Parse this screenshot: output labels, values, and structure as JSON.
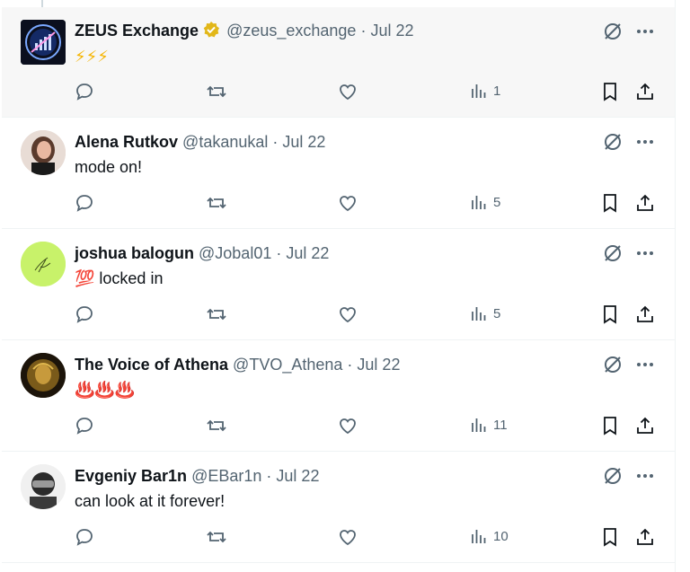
{
  "posts": [
    {
      "name": "ZEUS Exchange",
      "verified": true,
      "handle": "@zeus_exchange",
      "sep": "·",
      "date": "Jul 22",
      "text": "⚡⚡⚡",
      "views": "1",
      "avatar": "zeus-logo"
    },
    {
      "name": "Alena Rutkov",
      "verified": false,
      "handle": "@takanukal",
      "sep": "·",
      "date": "Jul 22",
      "text": "mode on!",
      "views": "5",
      "avatar": "photo-woman"
    },
    {
      "name": "joshua balogun",
      "verified": false,
      "handle": "@Jobal01",
      "sep": "·",
      "date": "Jul 22",
      "text": "💯 locked in",
      "views": "5",
      "avatar": "signature-green"
    },
    {
      "name": "The Voice of Athena",
      "verified": false,
      "handle": "@TVO_Athena",
      "sep": "·",
      "date": "Jul 22",
      "text": "♨️♨️♨️",
      "views": "11",
      "avatar": "athena-portrait"
    },
    {
      "name": "Evgeniy Bar1n",
      "verified": false,
      "handle": "@EBar1n",
      "sep": "·",
      "date": "Jul 22",
      "text": "can look at it forever!",
      "views": "10",
      "avatar": "helmet-figure"
    }
  ],
  "colors": {
    "accent": "#1d9bf0",
    "muted": "#536471",
    "verified_gold": "#e2b719",
    "border": "#eff3f4"
  }
}
